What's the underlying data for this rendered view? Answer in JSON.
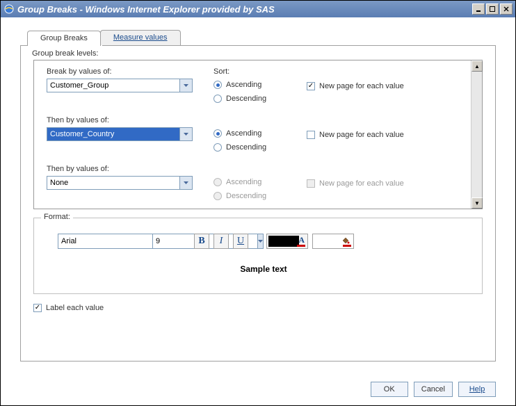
{
  "window": {
    "title": "Group Breaks - Windows Internet Explorer provided by SAS"
  },
  "tabs": {
    "group_breaks": "Group Breaks",
    "measure_values": "Measure values"
  },
  "group_levels_label": "Group break levels:",
  "labels": {
    "break_by": "Break by values of:",
    "then_by": "Then by values of:",
    "sort": "Sort:",
    "ascending": "Ascending",
    "descending": "Descending",
    "new_page": "New page for each value"
  },
  "breaks": [
    {
      "value": "Customer_Group",
      "sort": "Ascending",
      "new_page": true,
      "enabled": true,
      "highlighted": false
    },
    {
      "value": "Customer_Country",
      "sort": "Ascending",
      "new_page": false,
      "enabled": true,
      "highlighted": true
    },
    {
      "value": "None",
      "sort": "Ascending",
      "new_page": false,
      "enabled": false,
      "highlighted": false
    }
  ],
  "format": {
    "label": "Format:",
    "font": "Arial",
    "size": "9",
    "bold": "B",
    "italic": "I",
    "underline": "U",
    "text_color_swatch": "#000000",
    "text_color_letter": "A",
    "bg_color_swatch": "#ffffff",
    "sample": "Sample text"
  },
  "label_each": "Label each value",
  "buttons": {
    "ok": "OK",
    "cancel": "Cancel",
    "help": "Help"
  }
}
